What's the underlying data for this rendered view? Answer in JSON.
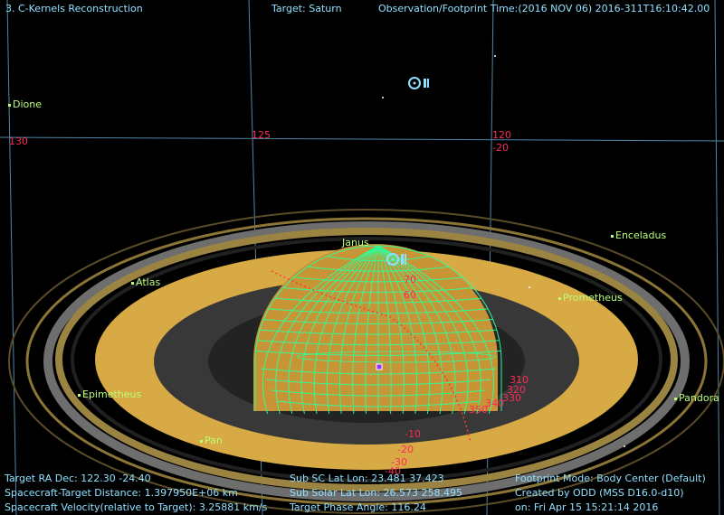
{
  "header": {
    "app_title": "3. C-Kernels Reconstruction",
    "target_label": "Target: Saturn",
    "time_label": "Observation/Footprint Time:(2016 NOV 06) 2016-311T16:10:42.00"
  },
  "grid_labels": {
    "ra_130": "130",
    "ra_125": "125",
    "ra_120": "120",
    "dec_m20": "-20"
  },
  "moons": {
    "dione": "Dione",
    "janus": "Janus",
    "enceladus": "Enceladus",
    "atlas": "Atlas",
    "prometheus": "Prometheus",
    "epimetheus": "Epimetheus",
    "pandora": "Pandora",
    "pan": "Pan"
  },
  "planet_grid": {
    "lat_labels": [
      "70",
      "60",
      "-10",
      "-20",
      "-30",
      "-40"
    ],
    "lon_labels": [
      "310",
      "320",
      "330",
      "340",
      "350"
    ]
  },
  "footer": {
    "left": [
      "Target RA Dec: 122.30  -24.40",
      "Spacecraft-Target Distance: 1.397950E+06 km",
      "Spacecraft Velocity(relative to Target): 3.25881 km/s"
    ],
    "middle": [
      "Sub SC Lat Lon: 23.481  37.423",
      "Sub Solar Lat Lon: 26.573  258.495",
      "Target Phase Angle: 116.24"
    ],
    "right": [
      "Footprint Mode: Body Center (Default)",
      "Created by ODD (MSS D16.0-d10)",
      "on: Fri Apr 15 15:21:14 2016"
    ]
  },
  "colors": {
    "background": "#000000",
    "sky_grid": "#4f86a8",
    "text_cyan": "#8fe0ff",
    "moon_label": "#b9ff7a",
    "planet_grid": "#2dff9a",
    "ring_gold": "#d8aa45",
    "ring_dark": "#383838",
    "grid_label": "#ff2a55"
  }
}
